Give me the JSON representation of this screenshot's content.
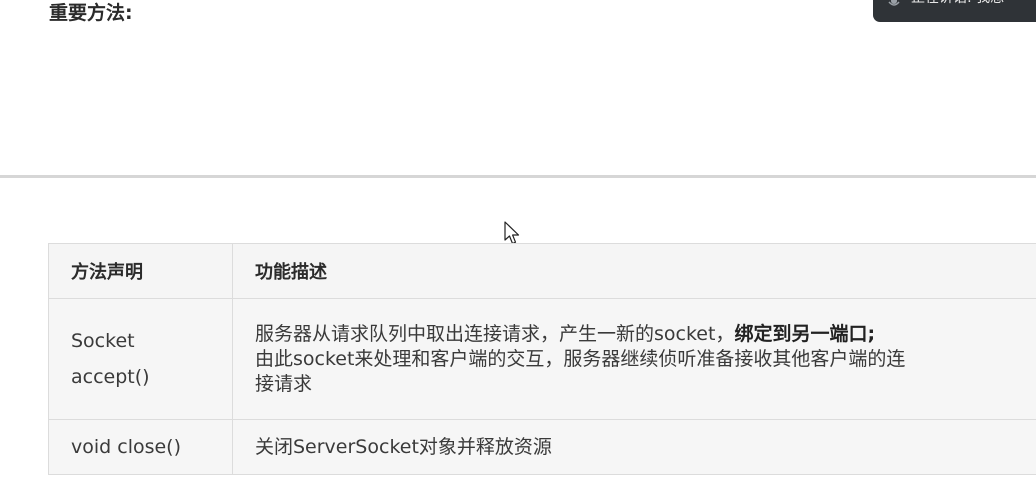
{
  "heading": "重要方法:",
  "toast": {
    "icon": "microphone-icon",
    "text": "正在讲话: 我想"
  },
  "table": {
    "headers": [
      "方法声明",
      "功能描述"
    ],
    "rows": [
      {
        "name_line1": "Socket",
        "name_line2": "accept()",
        "desc_line1_normal": "服务器从请求队列中取出连接请求，产生一新的socket，",
        "desc_line1_bold": "绑定到另一端口;",
        "desc_line2": "由此socket来处理和客户端的交互，服务器继续侦听准备接收其他客户端的连",
        "desc_line3": "接请求"
      },
      {
        "name": "void close()",
        "desc": "关闭ServerSocket对象并释放资源"
      }
    ]
  },
  "colors": {
    "toast_bg": "#2f3337",
    "header_bg": "#f5f5f5",
    "cell_bg": "#f6f6f6",
    "border": "#dcdcdc"
  }
}
